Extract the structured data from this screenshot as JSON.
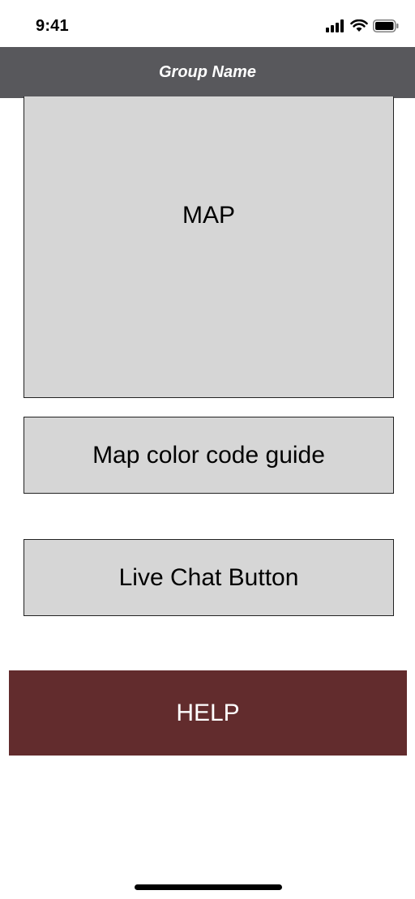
{
  "status_bar": {
    "time": "9:41",
    "icons": [
      "cellular-signal-icon",
      "wifi-icon",
      "battery-icon"
    ]
  },
  "header": {
    "title": "Group Name",
    "background_color": "#58585c"
  },
  "main": {
    "map_label": "MAP",
    "color_guide_label": "Map color code guide",
    "live_chat_label": "Live Chat Button",
    "help_label": "HELP",
    "help_color": "#622c2d",
    "placeholder_color": "#d6d6d6"
  }
}
